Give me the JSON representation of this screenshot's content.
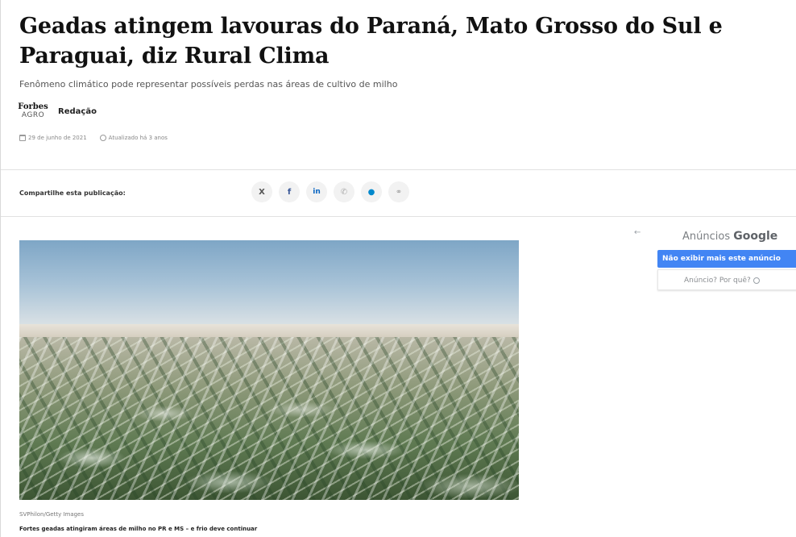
{
  "article": {
    "headline": "Geadas atingem lavouras do Paraná, Mato Grosso do Sul e Paraguai, diz Rural Clima",
    "subtitle": "Fenômeno climático pode representar possíveis perdas nas áreas de cultivo de milho",
    "brand_logo_line1": "Forbes",
    "brand_logo_line2": "AGRO",
    "author": "Redação",
    "date": "29 de junho de 2021",
    "updated": "Atualizado há 3 anos"
  },
  "share": {
    "label": "Compartilhe esta publicação:",
    "icons": {
      "x": "X",
      "facebook": "f",
      "linkedin": "in",
      "whatsapp": "✆",
      "telegram": "●",
      "link": "⚭"
    }
  },
  "image": {
    "credit": "SVPhilon/Getty Images",
    "caption": "Fortes geadas atingiram áreas de milho no PR e MS – e frio deve continuar"
  },
  "ad": {
    "back_arrow": "←",
    "label": "Anúncios",
    "brand": "Google",
    "dismiss": "Não exibir mais este anúncio",
    "why": "Anúncio? Por quê?"
  },
  "colors": {
    "ad_blue": "#4285f4",
    "linkedin": "#0a66c2",
    "telegram": "#0088cc",
    "facebook": "#3b5998"
  }
}
